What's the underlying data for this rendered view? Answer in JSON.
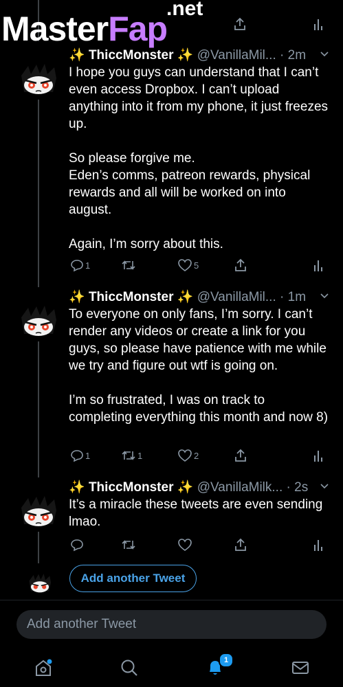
{
  "watermark": {
    "main_left": "Master",
    "main_right": "Fap",
    "superscript": ".net"
  },
  "tweets": [
    {
      "sparkle_left": "✨",
      "name": "ThiccMonster",
      "sparkle_right": "✨",
      "handle": "@VanillaMil...",
      "time": "· 2m",
      "paragraphs": [
        "I hope you guys can understand that I can’t even access Dropbox. I can’t upload anything into it from my phone, it just freezes up.",
        "So please forgive me.\nEden’s comms, patreon rewards, physical rewards and all will be worked on into august.",
        "Again, I’m sorry about this."
      ],
      "replies": "1",
      "retweets": "",
      "likes": "5"
    },
    {
      "sparkle_left": "✨",
      "name": "ThiccMonster",
      "sparkle_right": "✨",
      "handle": "@VanillaMil...",
      "time": "· 1m",
      "paragraphs": [
        "To everyone on only fans, I’m sorry. I can’t render any videos or create a link for you guys, so please have patience with me while we try and figure out wtf is going on.",
        "I’m so frustrated, I was on track to completing everything this month and now 8)"
      ],
      "replies": "1",
      "retweets": "1",
      "likes": "2"
    },
    {
      "sparkle_left": "✨",
      "name": "ThiccMonster",
      "sparkle_right": "✨",
      "handle": "@VanillaMilk...",
      "time": "· 2s",
      "paragraphs": [
        "It’s a miracle these tweets are even sending lmao."
      ],
      "replies": "",
      "retweets": "",
      "likes": ""
    }
  ],
  "add_tweet_button": "Add another Tweet",
  "compose_placeholder": "Add another Tweet",
  "notifications_badge": "1",
  "colors": {
    "accent": "#1d9bf0",
    "muted": "#8b98a5",
    "button_blue": "#4aa3e8",
    "background": "#000000"
  },
  "icons": [
    "reply-icon",
    "retweet-icon",
    "like-icon",
    "share-icon",
    "analytics-icon",
    "home-icon",
    "search-icon",
    "notifications-icon",
    "messages-icon",
    "more-caret-icon"
  ]
}
